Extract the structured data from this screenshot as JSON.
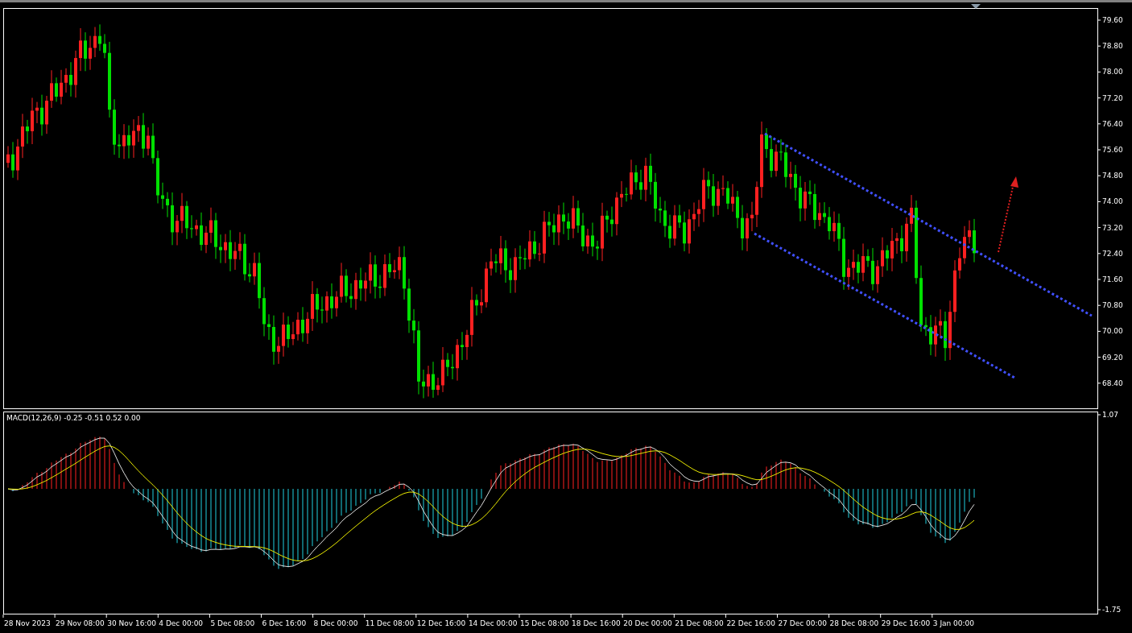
{
  "price_axis": [
    "79.60",
    "78.80",
    "78.00",
    "77.20",
    "76.40",
    "75.60",
    "74.80",
    "74.00",
    "73.20",
    "72.40",
    "71.60",
    "70.80",
    "70.00",
    "69.20",
    "68.40"
  ],
  "indicator": {
    "label": "MACD(12,26,9) -0.25 -0.51 0.52 0.00",
    "axis": [
      "1.07",
      "-1.75"
    ]
  },
  "time_axis": [
    "28 Nov 2023",
    "29 Nov 08:00",
    "30 Nov 16:00",
    "4 Dec 00:00",
    "5 Dec 08:00",
    "6 Dec 16:00",
    "8 Dec 00:00",
    "11 Dec 08:00",
    "12 Dec 16:00",
    "14 Dec 00:00",
    "15 Dec 08:00",
    "18 Dec 16:00",
    "20 Dec 00:00",
    "21 Dec 08:00",
    "22 Dec 16:00",
    "27 Dec 00:00",
    "28 Dec 08:00",
    "29 Dec 16:00",
    "3 Jan 00:00"
  ]
}
